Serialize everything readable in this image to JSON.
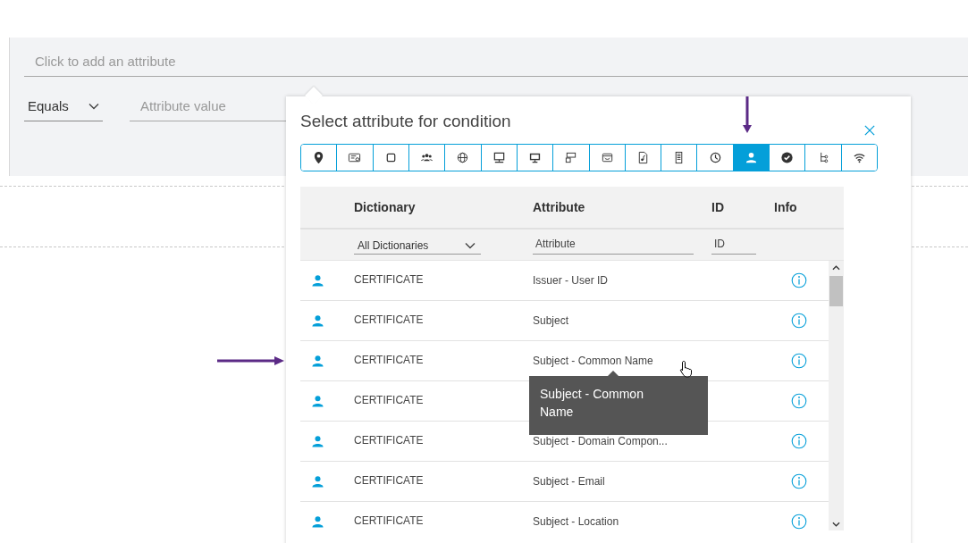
{
  "attribute_field": {
    "placeholder": "Click to add an attribute"
  },
  "operator": {
    "value": "Equals"
  },
  "value_field": {
    "placeholder": "Attribute value"
  },
  "dialog": {
    "title": "Select attribute for condition",
    "tabs": [
      {
        "selected": false
      },
      {
        "selected": false
      },
      {
        "selected": false
      },
      {
        "selected": false
      },
      {
        "selected": false
      },
      {
        "selected": false
      },
      {
        "selected": false
      },
      {
        "selected": false
      },
      {
        "selected": false
      },
      {
        "selected": false
      },
      {
        "selected": false
      },
      {
        "selected": false
      },
      {
        "selected": true
      },
      {
        "selected": false
      },
      {
        "selected": false
      },
      {
        "selected": false
      }
    ],
    "table": {
      "columns": [
        "Dictionary",
        "Attribute",
        "ID",
        "Info"
      ],
      "filters": {
        "dictionary": "All Dictionaries",
        "attribute": {
          "placeholder": "Attribute"
        },
        "id": {
          "placeholder": "ID"
        }
      },
      "rows": [
        {
          "dictionary": "CERTIFICATE",
          "attribute": "Issuer - User ID"
        },
        {
          "dictionary": "CERTIFICATE",
          "attribute": "Subject"
        },
        {
          "dictionary": "CERTIFICATE",
          "attribute": "Subject - Common Name"
        },
        {
          "dictionary": "CERTIFICATE",
          "attribute": ""
        },
        {
          "dictionary": "CERTIFICATE",
          "attribute": "Subject - Domain Compon..."
        },
        {
          "dictionary": "CERTIFICATE",
          "attribute": "Subject - Email"
        },
        {
          "dictionary": "CERTIFICATE",
          "attribute": "Subject - Location"
        }
      ]
    },
    "tooltip": "Subject - Common Name"
  }
}
